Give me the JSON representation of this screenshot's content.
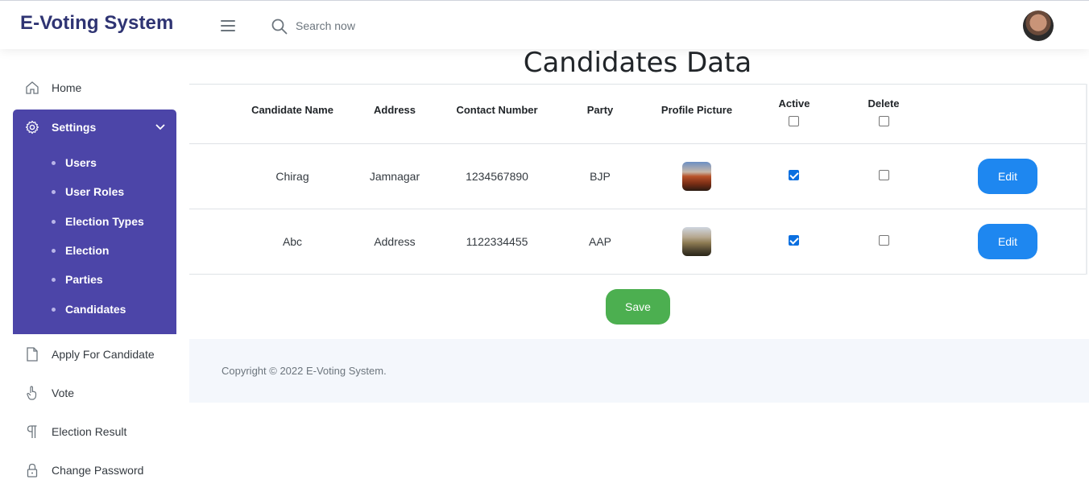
{
  "app": {
    "title": "E-Voting System"
  },
  "search": {
    "placeholder": "Search now"
  },
  "sidebar": {
    "home": "Home",
    "settings": {
      "label": "Settings",
      "items": [
        "Users",
        "User Roles",
        "Election Types",
        "Election",
        "Parties",
        "Candidates"
      ]
    },
    "apply": "Apply For Candidate",
    "vote": "Vote",
    "result": "Election Result",
    "password": "Change Password"
  },
  "main": {
    "title": "Candidates Data",
    "headers": {
      "name": "Candidate Name",
      "address": "Address",
      "contact": "Contact Number",
      "party": "Party",
      "picture": "Profile Picture",
      "active": "Active",
      "delete": "Delete"
    },
    "rows": [
      {
        "name": "Chirag",
        "address": "Jamnagar",
        "contact": "1234567890",
        "party": "BJP",
        "active": true,
        "delete": false,
        "edit": "Edit"
      },
      {
        "name": "Abc",
        "address": "Address",
        "contact": "1122334455",
        "party": "AAP",
        "active": true,
        "delete": false,
        "edit": "Edit"
      }
    ],
    "save": "Save"
  },
  "footer": {
    "copyright": "Copyright © 2022 E-Voting System."
  },
  "colors": {
    "brand": "#2f3473",
    "sidebar_active": "#4c45a8",
    "edit_button": "#1e87f0",
    "save_button": "#4caf50",
    "footer_bg": "#f4f7fc"
  }
}
